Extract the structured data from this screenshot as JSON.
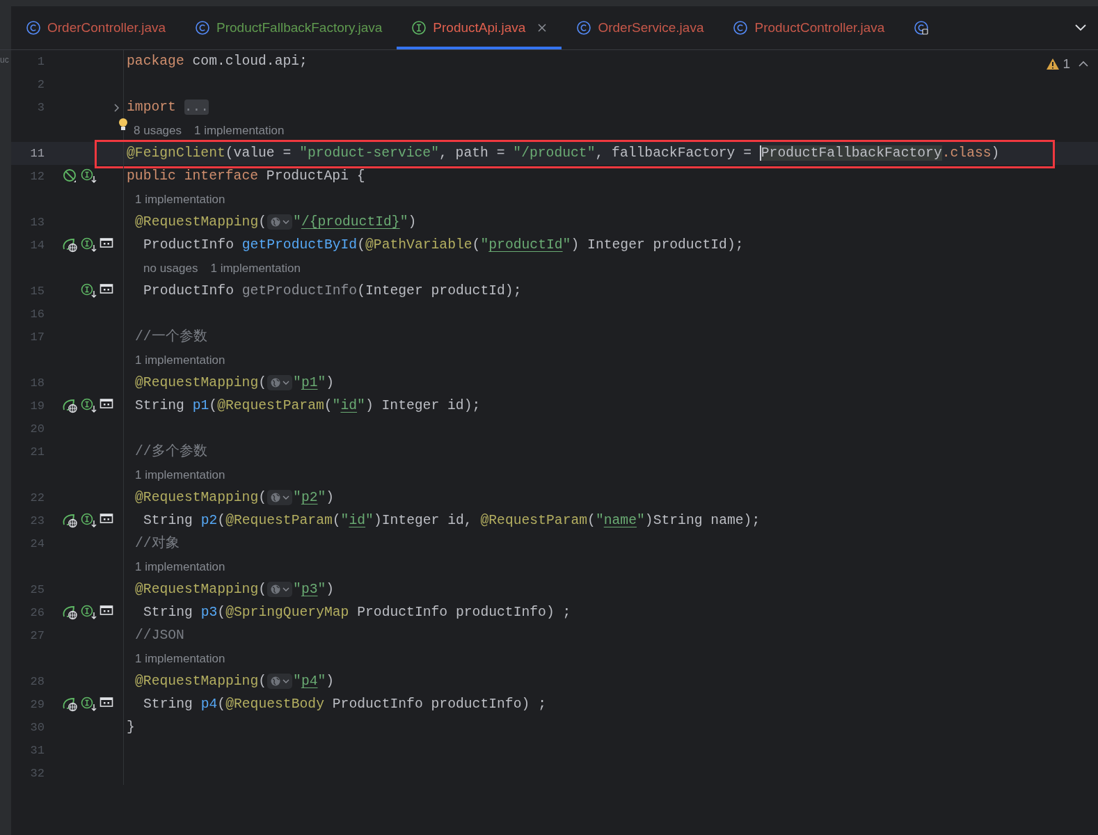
{
  "tabs": [
    {
      "label": "OrderController.java",
      "kind": "class",
      "color": "#c7584a",
      "selected": false
    },
    {
      "label": "ProductFallbackFactory.java",
      "kind": "class",
      "color": "#5f9a4f",
      "selected": false
    },
    {
      "label": "ProductApi.java",
      "kind": "interface",
      "color": "#e0604f",
      "selected": true
    },
    {
      "label": "OrderService.java",
      "kind": "class",
      "color": "#c7584a",
      "selected": false
    },
    {
      "label": "ProductController.java",
      "kind": "class",
      "color": "#c7584a",
      "selected": false
    },
    {
      "kind": "linked",
      "selected": false
    }
  ],
  "sidebar_fragment": "uc",
  "problems": {
    "count": "1"
  },
  "rows": [
    {
      "kind": "line",
      "number": "1",
      "icons": [],
      "tokens": [
        {
          "kind": "kw",
          "t": "package "
        },
        {
          "kind": "plain",
          "t": "com.cloud.api;"
        }
      ]
    },
    {
      "kind": "line",
      "number": "2",
      "icons": [],
      "tokens": []
    },
    {
      "kind": "line",
      "number": "3",
      "folded": true,
      "icons": [],
      "tokens": [
        {
          "kind": "kw",
          "t": "import "
        },
        {
          "kind": "fold",
          "t": "..."
        }
      ]
    },
    {
      "kind": "hint",
      "bulb": true,
      "texts": [
        "8 usages",
        "1 implementation"
      ]
    },
    {
      "kind": "line",
      "number": "11",
      "current": true,
      "framed": true,
      "icons": [],
      "tokens": [
        {
          "kind": "ann",
          "t": "@FeignClient"
        },
        {
          "kind": "plain",
          "t": "(value = "
        },
        {
          "kind": "str",
          "t": "\"product-service\""
        },
        {
          "kind": "plain",
          "t": ", path = "
        },
        {
          "kind": "str",
          "t": "\"/product\""
        },
        {
          "kind": "plain",
          "t": ", fallbackFactory = "
        },
        {
          "kind": "caret"
        },
        {
          "kind": "hl",
          "t": "ProductFallbackFactory"
        },
        {
          "kind": "kw",
          "t": ".class"
        },
        {
          "kind": "plain",
          "t": ")"
        }
      ]
    },
    {
      "kind": "line",
      "number": "12",
      "icons": [
        {
          "kind": "blocked"
        },
        {
          "kind": "impl"
        }
      ],
      "tokens": [
        {
          "kind": "kw",
          "t": "public interface "
        },
        {
          "kind": "plain",
          "t": "ProductApi {"
        }
      ]
    },
    {
      "kind": "hint",
      "texts": [
        "1 implementation"
      ]
    },
    {
      "kind": "member",
      "number": "13",
      "icons": [],
      "tokens": [
        {
          "kind": "ann",
          "t": "@RequestMapping"
        },
        {
          "kind": "plain",
          "t": "("
        },
        {
          "kind": "inlay"
        },
        {
          "kind": "str",
          "t": "\""
        },
        {
          "kind": "link",
          "t": "/{productId}"
        },
        {
          "kind": "str",
          "t": "\""
        },
        {
          "kind": "plain",
          "t": ")"
        }
      ]
    },
    {
      "kind": "nested",
      "number": "14",
      "icons": [
        {
          "kind": "web"
        },
        {
          "kind": "impl"
        },
        {
          "kind": "endpoint"
        }
      ],
      "tokens": [
        {
          "kind": "plain",
          "t": "ProductInfo "
        },
        {
          "kind": "method",
          "t": "getProductById"
        },
        {
          "kind": "plain",
          "t": "("
        },
        {
          "kind": "ann",
          "t": "@PathVariable"
        },
        {
          "kind": "plain",
          "t": "("
        },
        {
          "kind": "str",
          "t": "\""
        },
        {
          "kind": "link",
          "t": "productId"
        },
        {
          "kind": "str",
          "t": "\""
        },
        {
          "kind": "plain",
          "t": ") Integer productId);"
        }
      ]
    },
    {
      "kind": "hint",
      "texts": [
        "no usages",
        "1 implementation"
      ]
    },
    {
      "kind": "nested",
      "number": "15",
      "icons": [
        {
          "kind": "impl"
        },
        {
          "kind": "endpoint"
        }
      ],
      "tokens": [
        {
          "kind": "plain",
          "t": "ProductInfo "
        },
        {
          "kind": "unused",
          "t": "getProductInfo"
        },
        {
          "kind": "plain",
          "t": "(Integer productId);"
        }
      ]
    },
    {
      "kind": "line",
      "number": "16",
      "icons": [],
      "tokens": []
    },
    {
      "kind": "member",
      "number": "17",
      "icons": [],
      "tokens": [
        {
          "kind": "comment",
          "t": "//一个参数"
        }
      ]
    },
    {
      "kind": "hint",
      "texts": [
        "1 implementation"
      ]
    },
    {
      "kind": "member",
      "number": "18",
      "icons": [],
      "tokens": [
        {
          "kind": "ann",
          "t": "@RequestMapping"
        },
        {
          "kind": "plain",
          "t": "("
        },
        {
          "kind": "inlay"
        },
        {
          "kind": "str",
          "t": "\""
        },
        {
          "kind": "link",
          "t": "p1"
        },
        {
          "kind": "str",
          "t": "\""
        },
        {
          "kind": "plain",
          "t": ")"
        }
      ]
    },
    {
      "kind": "member",
      "number": "19",
      "icons": [
        {
          "kind": "web"
        },
        {
          "kind": "impl"
        },
        {
          "kind": "endpoint"
        }
      ],
      "tokens": [
        {
          "kind": "plain",
          "t": "String "
        },
        {
          "kind": "method",
          "t": "p1"
        },
        {
          "kind": "plain",
          "t": "("
        },
        {
          "kind": "ann",
          "t": "@RequestParam"
        },
        {
          "kind": "plain",
          "t": "("
        },
        {
          "kind": "str",
          "t": "\""
        },
        {
          "kind": "link",
          "t": "id"
        },
        {
          "kind": "str",
          "t": "\""
        },
        {
          "kind": "plain",
          "t": ") Integer id);"
        }
      ]
    },
    {
      "kind": "line",
      "number": "20",
      "icons": [],
      "tokens": []
    },
    {
      "kind": "member",
      "number": "21",
      "icons": [],
      "tokens": [
        {
          "kind": "comment",
          "t": "//多个参数"
        }
      ]
    },
    {
      "kind": "hint",
      "texts": [
        "1 implementation"
      ]
    },
    {
      "kind": "member",
      "number": "22",
      "icons": [],
      "tokens": [
        {
          "kind": "ann",
          "t": "@RequestMapping"
        },
        {
          "kind": "plain",
          "t": "("
        },
        {
          "kind": "inlay"
        },
        {
          "kind": "str",
          "t": "\""
        },
        {
          "kind": "link",
          "t": "p2"
        },
        {
          "kind": "str",
          "t": "\""
        },
        {
          "kind": "plain",
          "t": ")"
        }
      ]
    },
    {
      "kind": "nested",
      "number": "23",
      "icons": [
        {
          "kind": "web"
        },
        {
          "kind": "impl"
        },
        {
          "kind": "endpoint"
        }
      ],
      "tokens": [
        {
          "kind": "plain",
          "t": "String "
        },
        {
          "kind": "method",
          "t": "p2"
        },
        {
          "kind": "plain",
          "t": "("
        },
        {
          "kind": "ann",
          "t": "@RequestParam"
        },
        {
          "kind": "plain",
          "t": "("
        },
        {
          "kind": "str",
          "t": "\""
        },
        {
          "kind": "link",
          "t": "id"
        },
        {
          "kind": "str",
          "t": "\""
        },
        {
          "kind": "plain",
          "t": ")Integer id, "
        },
        {
          "kind": "ann",
          "t": "@RequestParam"
        },
        {
          "kind": "plain",
          "t": "("
        },
        {
          "kind": "str",
          "t": "\""
        },
        {
          "kind": "link",
          "t": "name"
        },
        {
          "kind": "str",
          "t": "\""
        },
        {
          "kind": "plain",
          "t": ")String name);"
        }
      ]
    },
    {
      "kind": "member",
      "number": "24",
      "icons": [],
      "tokens": [
        {
          "kind": "comment",
          "t": "//对象"
        }
      ]
    },
    {
      "kind": "hint",
      "texts": [
        "1 implementation"
      ]
    },
    {
      "kind": "member",
      "number": "25",
      "icons": [],
      "tokens": [
        {
          "kind": "ann",
          "t": "@RequestMapping"
        },
        {
          "kind": "plain",
          "t": "("
        },
        {
          "kind": "inlay"
        },
        {
          "kind": "str",
          "t": "\""
        },
        {
          "kind": "link",
          "t": "p3"
        },
        {
          "kind": "str",
          "t": "\""
        },
        {
          "kind": "plain",
          "t": ")"
        }
      ]
    },
    {
      "kind": "nested",
      "number": "26",
      "icons": [
        {
          "kind": "web"
        },
        {
          "kind": "impl"
        },
        {
          "kind": "endpoint"
        }
      ],
      "tokens": [
        {
          "kind": "plain",
          "t": "String "
        },
        {
          "kind": "method",
          "t": "p3"
        },
        {
          "kind": "plain",
          "t": "("
        },
        {
          "kind": "ann",
          "t": "@SpringQueryMap"
        },
        {
          "kind": "plain",
          "t": " ProductInfo productInfo) ;"
        }
      ]
    },
    {
      "kind": "member",
      "number": "27",
      "icons": [],
      "tokens": [
        {
          "kind": "comment",
          "t": "//JSON"
        }
      ]
    },
    {
      "kind": "hint",
      "texts": [
        "1 implementation"
      ]
    },
    {
      "kind": "member",
      "number": "28",
      "icons": [],
      "tokens": [
        {
          "kind": "ann",
          "t": "@RequestMapping"
        },
        {
          "kind": "plain",
          "t": "("
        },
        {
          "kind": "inlay"
        },
        {
          "kind": "str",
          "t": "\""
        },
        {
          "kind": "link",
          "t": "p4"
        },
        {
          "kind": "str",
          "t": "\""
        },
        {
          "kind": "plain",
          "t": ")"
        }
      ]
    },
    {
      "kind": "nested",
      "number": "29",
      "icons": [
        {
          "kind": "web"
        },
        {
          "kind": "impl"
        },
        {
          "kind": "endpoint"
        }
      ],
      "tokens": [
        {
          "kind": "plain",
          "t": "String "
        },
        {
          "kind": "method",
          "t": "p4"
        },
        {
          "kind": "plain",
          "t": "("
        },
        {
          "kind": "ann",
          "t": "@RequestBody"
        },
        {
          "kind": "plain",
          "t": " ProductInfo productInfo) ;"
        }
      ]
    },
    {
      "kind": "line",
      "number": "30",
      "icons": [],
      "tokens": [
        {
          "kind": "plain",
          "t": "}"
        }
      ]
    },
    {
      "kind": "line",
      "number": "31",
      "icons": [],
      "tokens": []
    },
    {
      "kind": "line",
      "number": "32",
      "icons": [],
      "tokens": []
    }
  ]
}
